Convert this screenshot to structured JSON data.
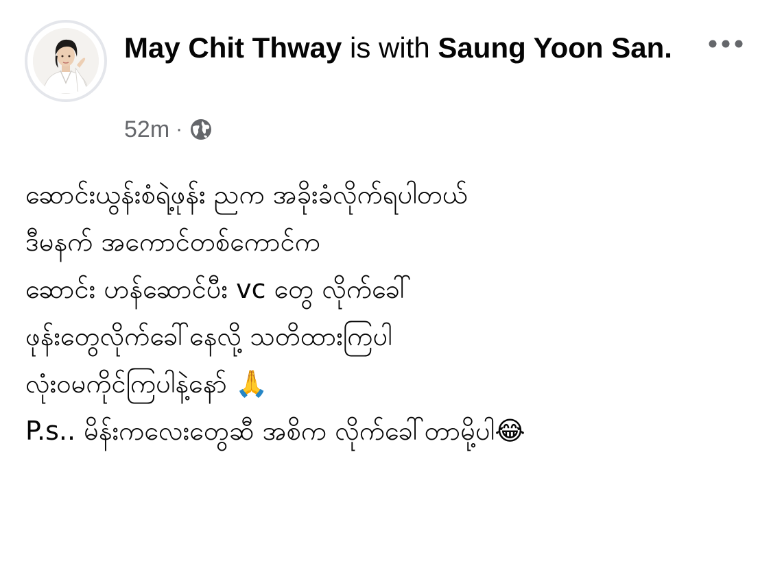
{
  "post": {
    "author": "May Chit Thway",
    "with_text": " is with ",
    "tagged": "Saung Yoon San",
    "end_punct": ".",
    "time": "52m",
    "dot": "·",
    "privacy_icon": "globe-icon",
    "more_icon": "more-options-icon",
    "lines": [
      "ဆောင်းယွန်းစံရဲ့ဖုန်း ညက အခိုးခံလိုက်ရပါတယ်",
      "ဒီမနက် အကောင်တစ်ကောင်က",
      "ဆောင်း ဟန်ဆောင်ပီး vc တွေ လိုက်ခေါ်",
      "ဖုန်းတွေလိုက်ခေါ်နေလို့ သတိထားကြပါ",
      "လုံးဝမကိုင်ကြပါနဲ့နော် 🙏",
      "P.s.. မိန်းကလေးတွေဆီ အစိက လိုက်ခေါ်တာမို့ပါ😂"
    ]
  },
  "colors": {
    "text": "#050505",
    "secondary_text": "#65676b",
    "avatar_ring": "#e4e6eb"
  }
}
